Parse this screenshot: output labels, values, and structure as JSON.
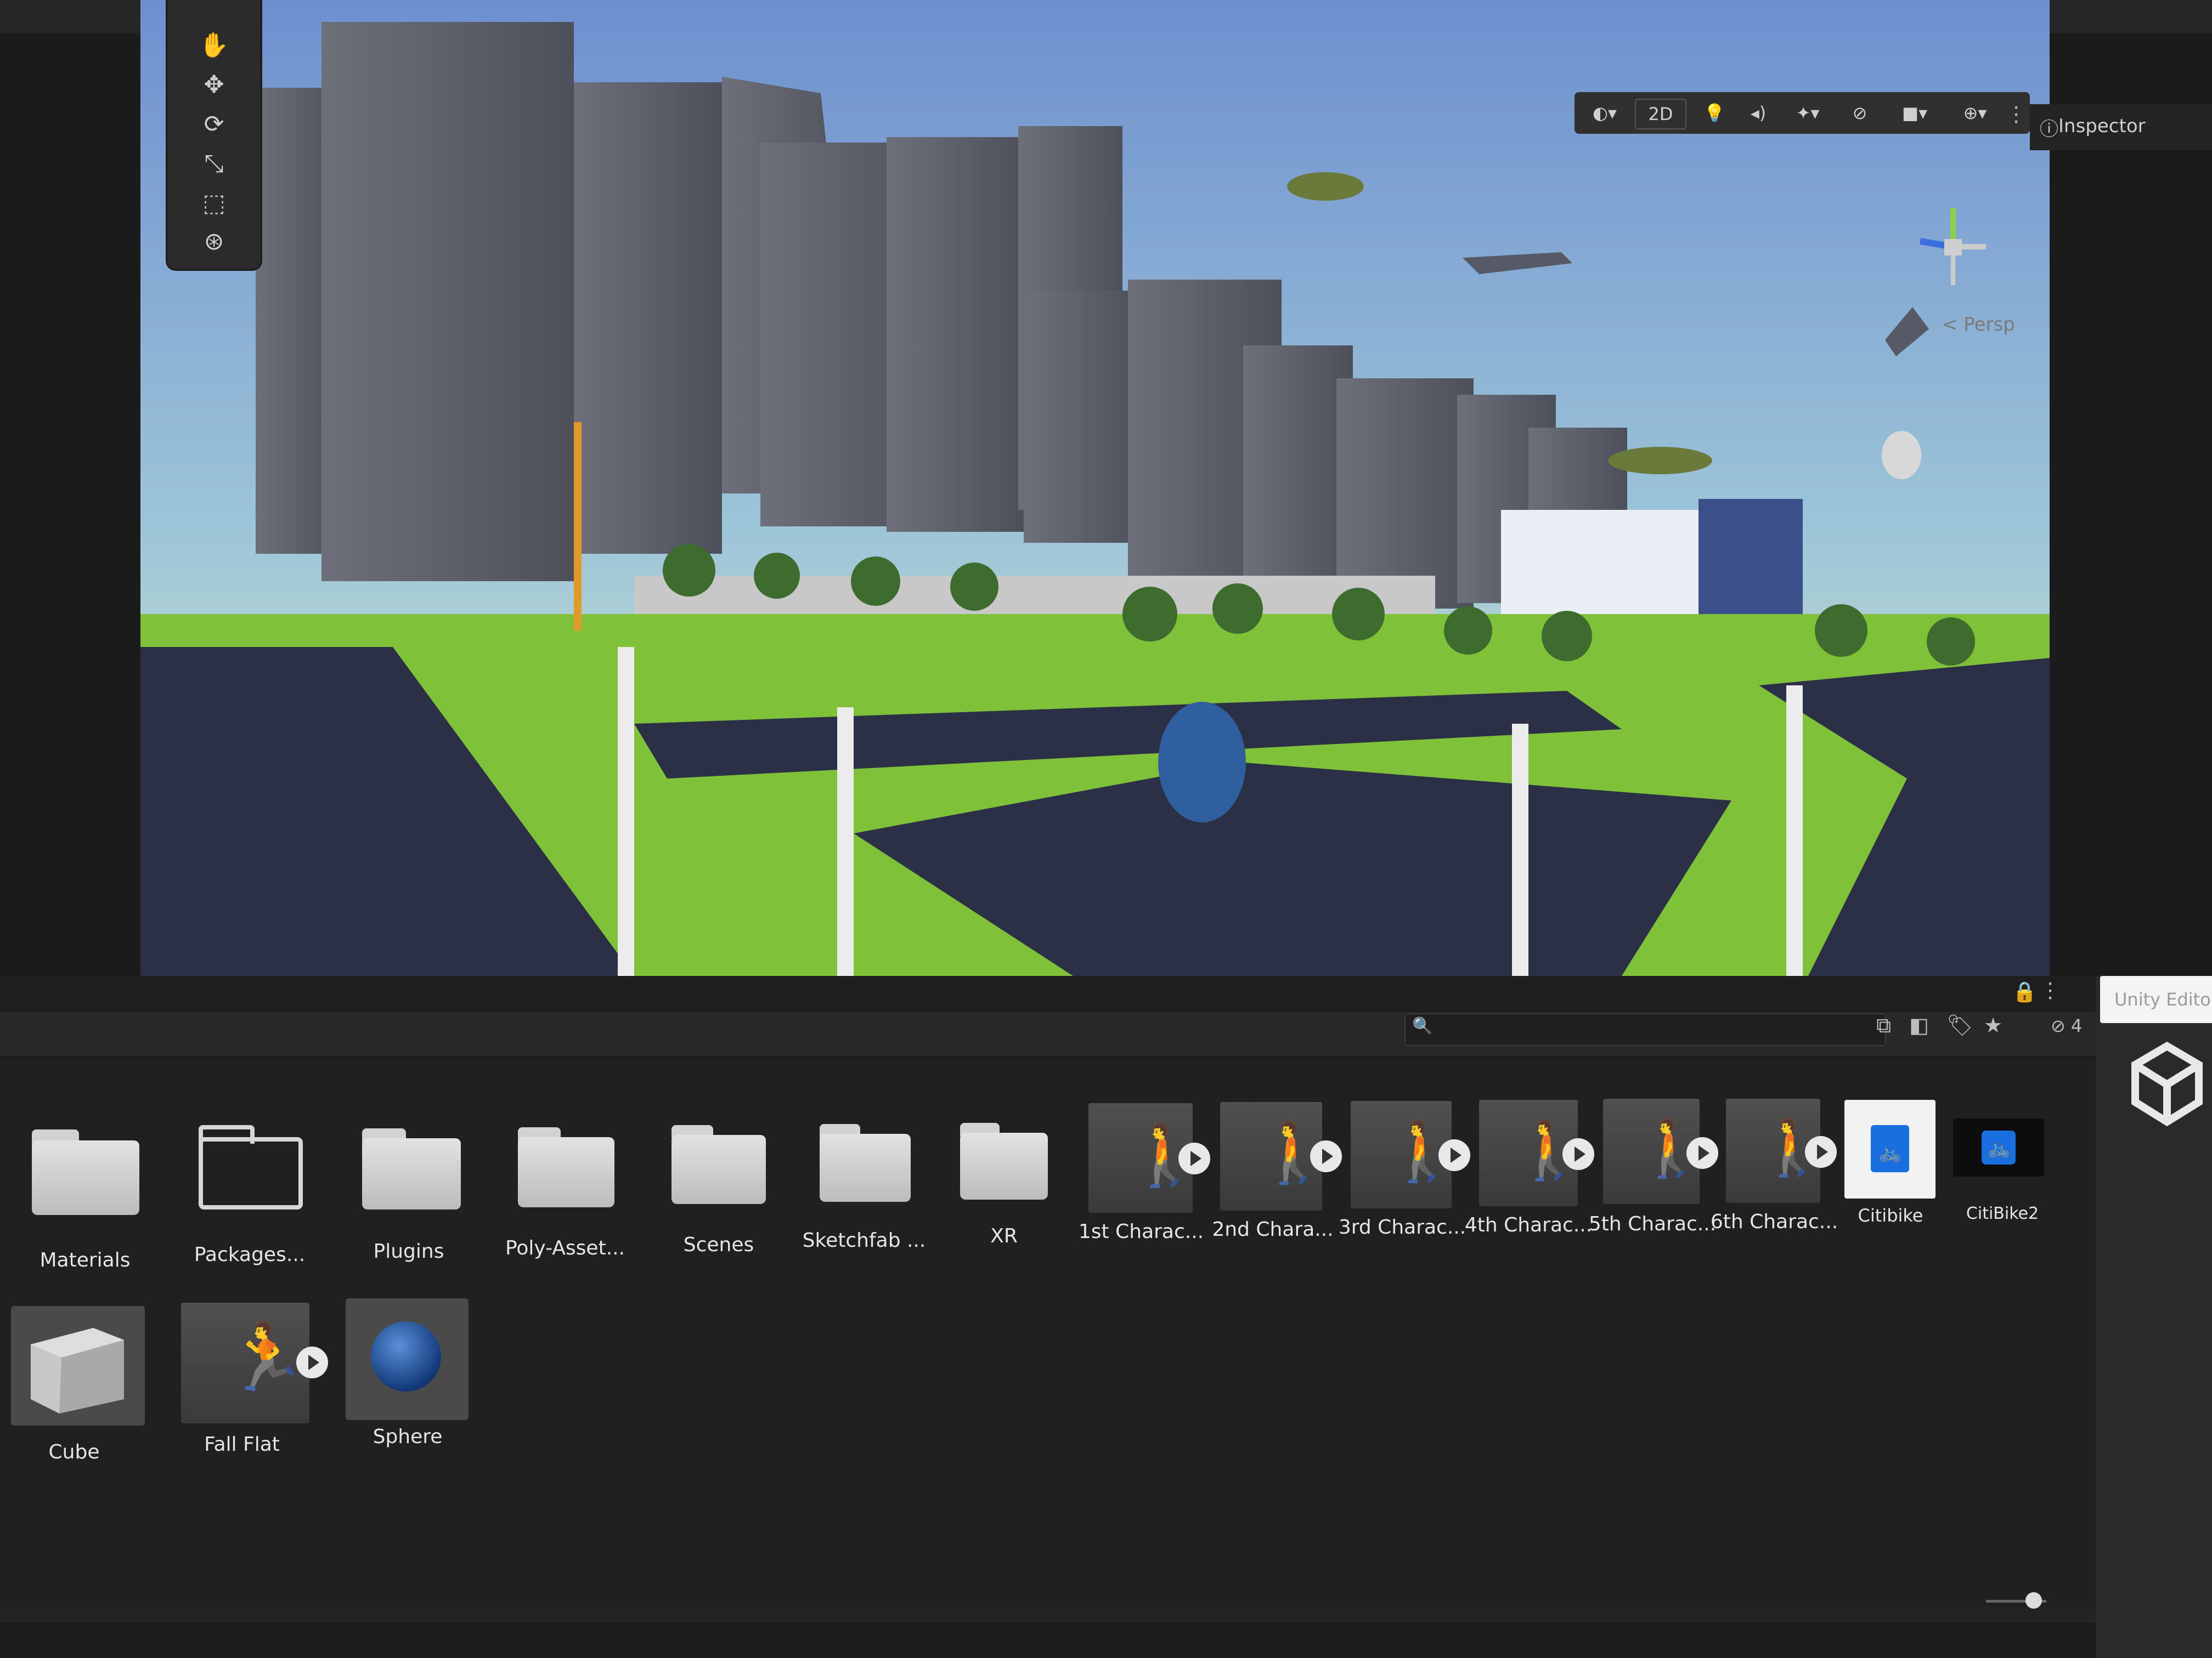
{
  "inspector": {
    "label": "Inspector"
  },
  "scene_toolbar": {
    "two_d_label": "2D",
    "gizmo_label": "< Persp"
  },
  "tooltip": {
    "text": "Unity Editor U"
  },
  "project": {
    "search": {
      "placeholder": ""
    },
    "hidden_packages_count": "4",
    "folders": [
      "Materials",
      "Packages...",
      "Plugins",
      "Poly-Asset...",
      "Scenes",
      "Sketchfab ...",
      "XR"
    ],
    "characters": [
      "1st Charac...",
      "2nd Chara...",
      "3rd Charac...",
      "4th Charac...",
      "5th Charac...",
      "6th Charac..."
    ],
    "images": [
      "Citibike",
      "CitiBike2"
    ],
    "row2": [
      "Cube",
      "Fall Flat",
      "Sphere"
    ]
  },
  "icons": {
    "hand": "hand-icon",
    "move": "move-icon",
    "rotate": "rotate-icon",
    "scale": "scale-icon",
    "rect": "rect-icon",
    "transform": "transform-icon"
  },
  "colors": {
    "editor_bg": "#232323",
    "citibike_blue": "#1a6fe0",
    "sky_light": "#c8e3e0",
    "sky_blue": "#6e8fcf",
    "grass": "#7fc23a",
    "asphalt": "#2c3046"
  }
}
